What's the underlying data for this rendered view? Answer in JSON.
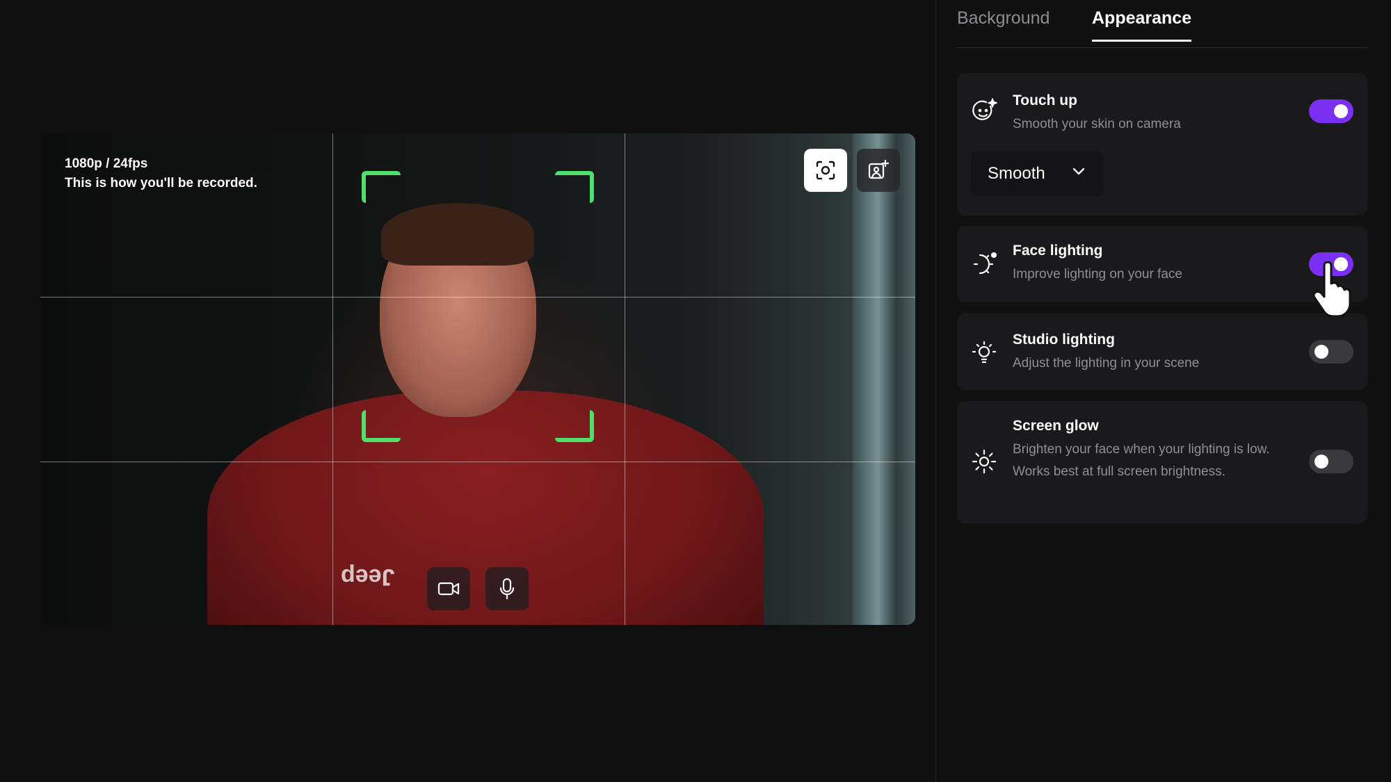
{
  "preview": {
    "resolution": "1080p / 24fps",
    "note": "This is how you'll be recorded.",
    "capture_button_icon": "camera-focus-icon",
    "effects_button_icon": "image-sparkle-icon",
    "camera_button_icon": "video-camera-icon",
    "mic_button_icon": "microphone-icon",
    "shirt_text": "Jeep",
    "frame_color": "#4ee06a"
  },
  "tabs": [
    {
      "label": "Background",
      "active": false
    },
    {
      "label": "Appearance",
      "active": true
    }
  ],
  "settings": {
    "touch_up": {
      "title": "Touch up",
      "description": "Smooth your skin on camera",
      "enabled": true,
      "icon": "face-sparkle-icon",
      "option": "Smooth"
    },
    "face_lighting": {
      "title": "Face lighting",
      "description": "Improve lighting on your face",
      "enabled": true,
      "icon": "face-light-icon"
    },
    "studio_lighting": {
      "title": "Studio lighting",
      "description": "Adjust the lighting in your scene",
      "enabled": false,
      "icon": "bulb-icon"
    },
    "screen_glow": {
      "title": "Screen glow",
      "description": "Brighten your face when your lighting is low. Works best at full screen brightness.",
      "enabled": false,
      "icon": "sun-icon"
    }
  },
  "accent_color": "#7b2ff2"
}
